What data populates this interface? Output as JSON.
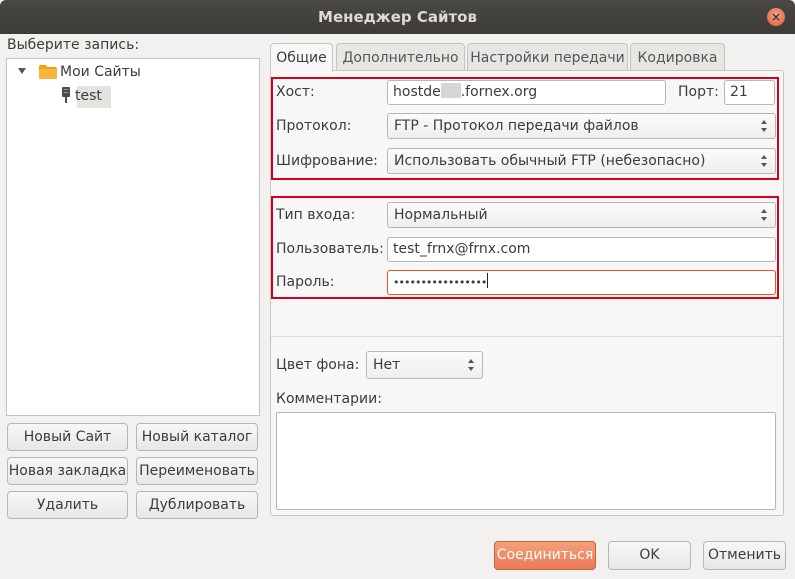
{
  "window": {
    "title": "Менеджер Сайтов"
  },
  "left": {
    "select_label": "Выберите запись:",
    "tree": [
      {
        "label": "Мои Сайты",
        "type": "folder",
        "expanded": true
      },
      {
        "label": "test",
        "type": "server",
        "selected": true
      }
    ],
    "buttons": {
      "new_site": "Новый Сайт",
      "new_folder": "Новый каталог",
      "new_bookmark": "Новая закладка",
      "rename": "Переименовать",
      "delete": "Удалить",
      "duplicate": "Дублировать"
    }
  },
  "tabs": [
    {
      "label": "Общие",
      "active": true
    },
    {
      "label": "Дополнительно",
      "active": false
    },
    {
      "label": "Настройки передачи",
      "active": false
    },
    {
      "label": "Кодировка",
      "active": false
    }
  ],
  "general": {
    "host_label": "Хост:",
    "host_prefix": "hostde",
    "host_suffix": ".fornex.org",
    "port_label": "Порт:",
    "port_value": "21",
    "protocol_label": "Протокол:",
    "protocol_value": "FTP - Протокол передачи файлов",
    "encryption_label": "Шифрование:",
    "encryption_value": "Использовать обычный FTP (небезопасно)",
    "logon_type_label": "Тип входа:",
    "logon_type_value": "Нормальный",
    "user_label": "Пользователь:",
    "user_value": "test_frnx@frnx.com",
    "password_label": "Пароль:",
    "password_value": "•••••••••••••••••",
    "bg_color_label": "Цвет фона:",
    "bg_color_value": "Нет",
    "comments_label": "Комментарии:",
    "comments_value": ""
  },
  "footer": {
    "connect": "Соединиться",
    "ok": "OK",
    "cancel": "Отменить"
  },
  "colors": {
    "highlight_box": "#d6001c",
    "primary_button": "#ea7c55",
    "focus_border": "#e95420"
  }
}
